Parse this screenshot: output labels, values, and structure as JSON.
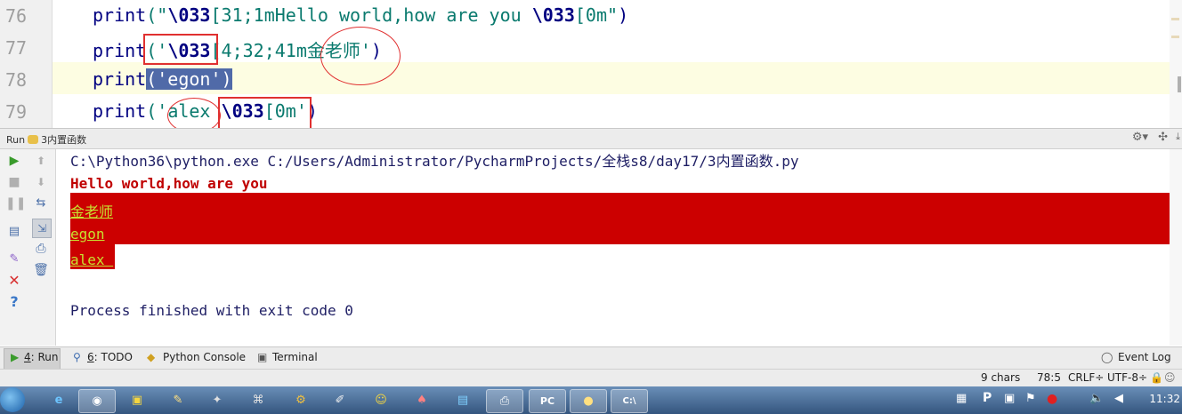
{
  "editor": {
    "lines": [
      {
        "number": "76",
        "code": "print(\"\\033[31;1mHello world,how are you \\033[0m\")"
      },
      {
        "number": "77",
        "code": "print('\\033[4;32;41m金老师')"
      },
      {
        "number": "78",
        "code": "print('egon')"
      },
      {
        "number": "79",
        "code": "print('alex \\033[0m')"
      }
    ],
    "line76": {
      "fn": "print",
      "open": "(\"",
      "esc1": "\\033",
      "text": "[31;1mHello world,how are you ",
      "esc2": "\\033",
      "tail": "[0m\"",
      "close": ")"
    },
    "line77": {
      "fn": "print",
      "open": "('",
      "esc": "\\033",
      "text": "[4;32;41m金老师'",
      "close": ")"
    },
    "line78": {
      "fn_a": "prin",
      "fn_b": "t",
      "sel": "('egon')"
    },
    "line79": {
      "fn": "print",
      "open": "('",
      "text": "alex ",
      "esc": "\\033",
      "tail": "[0m'",
      "close": ")"
    }
  },
  "run_window": {
    "label": "Run",
    "config": "3内置函数",
    "command": "C:\\Python36\\python.exe C:/Users/Administrator/PycharmProjects/全栈s8/day17/3内置函数.py",
    "output": [
      "Hello world,how are you",
      "金老师",
      "egon",
      "alex "
    ],
    "exit": "Process finished with exit code 0"
  },
  "tool_strip": {
    "run": {
      "num": "4",
      "rest": ": Run"
    },
    "todo": {
      "num": "6",
      "rest": ": TODO"
    },
    "python_console": "Python Console",
    "terminal": "Terminal",
    "event_log": "Event Log"
  },
  "status": {
    "chars": "9 chars",
    "position": "78:5",
    "line_sep": "CRLF÷",
    "encoding": "UTF-8÷"
  },
  "taskbar": {
    "apps": [
      "ie-icon",
      "chrome-icon",
      "app-icon",
      "notepad-icon",
      "pin-icon",
      "network-icon",
      "gear-icon",
      "paint-icon",
      "emoji-icon",
      "bird-icon",
      "folder-icon",
      "printer-icon",
      "pycharm-icon",
      "python-icon",
      "cmd-icon"
    ],
    "pycharm": "PC",
    "cmd": "C:\\",
    "clock": "11:32"
  },
  "colors": {
    "red_output": "#c00000",
    "red_band": "#cc0000",
    "green_text": "#c8e030",
    "selection": "#506aa8",
    "annotation": "#e03030"
  }
}
